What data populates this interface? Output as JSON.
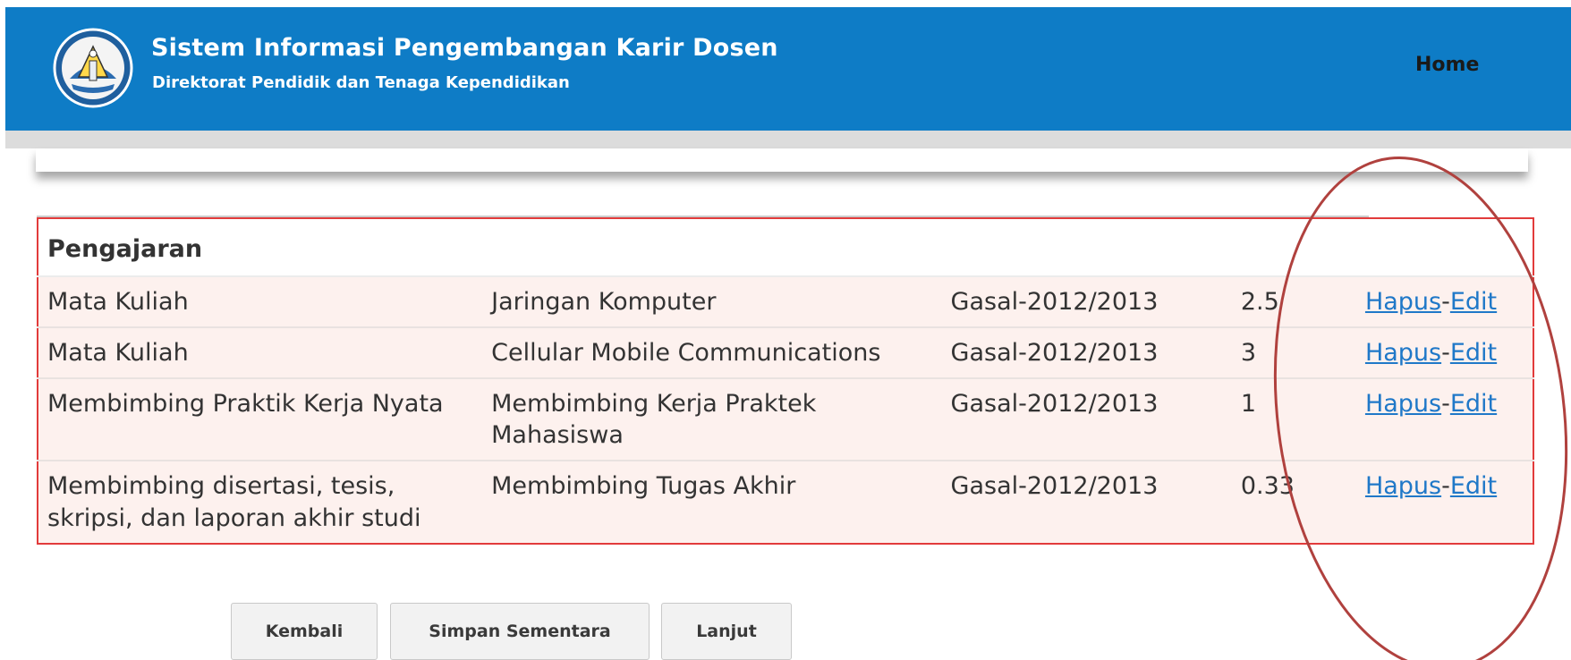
{
  "header": {
    "title": "Sistem Informasi Pengembangan Karir Dosen",
    "subtitle": "Direktorat Pendidik dan Tenaga Kependidikan",
    "logo_icon": "tut-wuri-handayani-logo-icon",
    "nav": {
      "home_label": "Home"
    },
    "background_color": "#0e7cc6"
  },
  "table": {
    "section_title": "Pengajaran",
    "rows": [
      {
        "kategori": "Mata Kuliah",
        "nama": "Jaringan Komputer",
        "semester": "Gasal-2012/2013",
        "sks": "2.5",
        "hapus": "Hapus",
        "sep": "-",
        "edit": "Edit"
      },
      {
        "kategori": "Mata Kuliah",
        "nama": "Cellular Mobile Communications",
        "semester": "Gasal-2012/2013",
        "sks": "3",
        "hapus": "Hapus",
        "sep": "-",
        "edit": "Edit"
      },
      {
        "kategori": "Membimbing Praktik Kerja Nyata",
        "nama": "Membimbing Kerja Praktek Mahasiswa",
        "semester": "Gasal-2012/2013",
        "sks": "1",
        "hapus": "Hapus",
        "sep": "-",
        "edit": "Edit"
      },
      {
        "kategori": "Membimbing disertasi, tesis, skripsi, dan laporan akhir studi",
        "nama": "Membimbing Tugas Akhir",
        "semester": "Gasal-2012/2013",
        "sks": "0.33",
        "hapus": "Hapus",
        "sep": "-",
        "edit": "Edit"
      }
    ],
    "row_background": "#fdf1ee",
    "border_color": "#e23b3b",
    "link_color": "#1f78c8"
  },
  "buttons": {
    "back_label": "Kembali",
    "save_draft_label": "Simpan Sementara",
    "next_label": "Lanjut"
  },
  "annotation": {
    "shape": "ellipse-highlight",
    "color": "#b0413e"
  }
}
